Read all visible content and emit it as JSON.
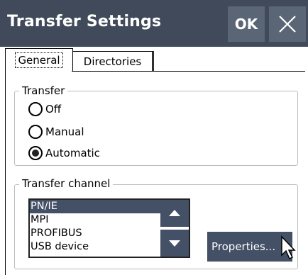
{
  "window": {
    "title": "Transfer Settings",
    "ok_label": "OK"
  },
  "tabs": [
    {
      "label": "General",
      "active": true
    },
    {
      "label": "Directories",
      "active": false
    }
  ],
  "transfer": {
    "legend": "Transfer",
    "options": [
      {
        "label": "Off",
        "selected": false
      },
      {
        "label": "Manual",
        "selected": false
      },
      {
        "label": "Automatic",
        "selected": true
      }
    ]
  },
  "channel": {
    "legend": "Transfer channel",
    "items": [
      "PN/IE",
      "MPI",
      "PROFIBUS",
      "USB device"
    ],
    "selected_index": 0,
    "properties_label": "Properties..."
  },
  "icons": {
    "close": "close-icon",
    "up": "arrow-up-icon",
    "down": "arrow-down-icon",
    "cursor": "mouse-pointer-icon"
  },
  "colors": {
    "titlebar": "#404a5a",
    "button": "#5a6575",
    "accent": "#445066"
  }
}
